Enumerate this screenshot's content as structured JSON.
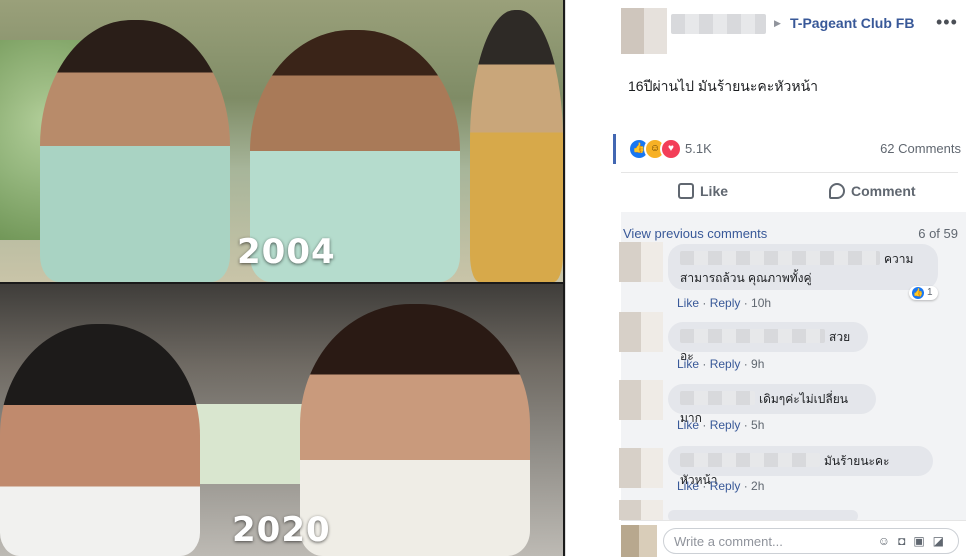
{
  "photo": {
    "top_year": "2004",
    "bottom_year": "2020"
  },
  "post": {
    "page_name": "T-Pageant Club FB",
    "more_icon": "more-options-icon",
    "caption": "16ปีผ่านไป มันร้ายนะคะหัวหน้า",
    "reaction_count": "5.1K",
    "comment_count": "62 Comments",
    "reactions": [
      "like",
      "haha",
      "love"
    ]
  },
  "actions": {
    "like_label": "Like",
    "comment_label": "Comment"
  },
  "thread": {
    "view_previous": "View previous comments",
    "position": "6 of 59",
    "comments": [
      {
        "text_line1": "ความ",
        "text_line2": "สามารถล้วน คุณภาพทั้งคู่",
        "like": "Like",
        "reply": "Reply",
        "time": "10h",
        "likes": "1"
      },
      {
        "text_line1": "สวยอะ",
        "like": "Like",
        "reply": "Reply",
        "time": "9h"
      },
      {
        "text_line1": "เดิมๆค่ะไม่เปลี่ยนมาก",
        "like": "Like",
        "reply": "Reply",
        "time": "5h"
      },
      {
        "text_line1": "มันร้ายนะคะหัวหน้า",
        "like": "Like",
        "reply": "Reply",
        "time": "2h"
      }
    ]
  },
  "composer": {
    "placeholder": "Write a comment..."
  }
}
